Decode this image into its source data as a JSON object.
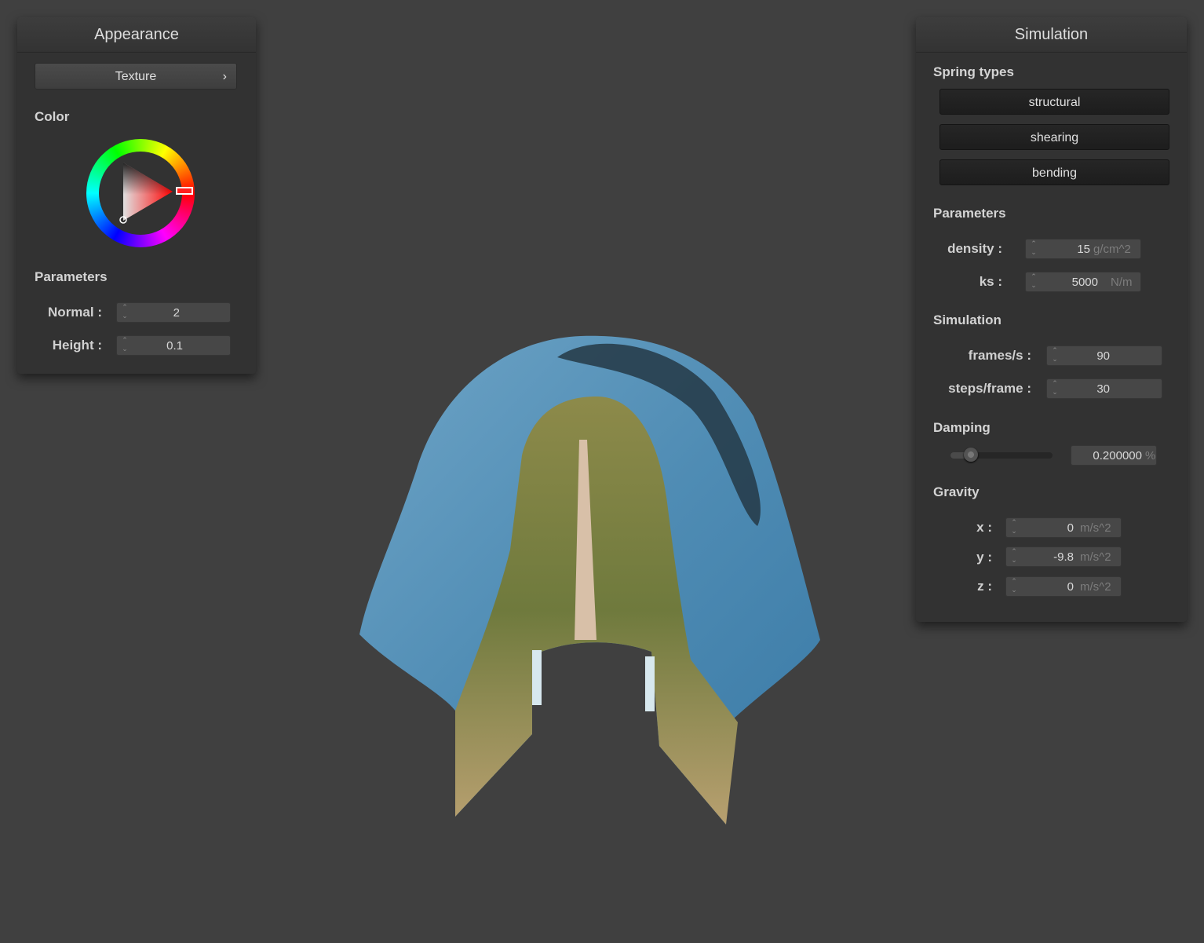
{
  "appearance": {
    "title": "Appearance",
    "texture_button": "Texture",
    "texture_chevron": "›",
    "color_label": "Color",
    "parameters_label": "Parameters",
    "normal_label": "Normal :",
    "normal_value": "2",
    "height_label": "Height :",
    "height_value": "0.1",
    "color_value": "#ff0000"
  },
  "simulation": {
    "title": "Simulation",
    "spring_types_label": "Spring types",
    "spring_buttons": [
      "structural",
      "shearing",
      "bending"
    ],
    "parameters_label": "Parameters",
    "density_label": "density :",
    "density_value": "15",
    "density_unit": "g/cm^2",
    "ks_label": "ks :",
    "ks_value": "5000",
    "ks_unit": "N/m",
    "simulation_label": "Simulation",
    "fps_label": "frames/s :",
    "fps_value": "90",
    "steps_label": "steps/frame :",
    "steps_value": "30",
    "damping_label": "Damping",
    "damping_value": "0.200000",
    "damping_unit": "%",
    "damping_slider_fraction": 0.2,
    "gravity_label": "Gravity",
    "gx_label": "x :",
    "gx_value": "0",
    "gy_label": "y :",
    "gy_value": "-9.8",
    "gz_label": "z :",
    "gz_value": "0",
    "gravity_unit": "m/s^2"
  }
}
